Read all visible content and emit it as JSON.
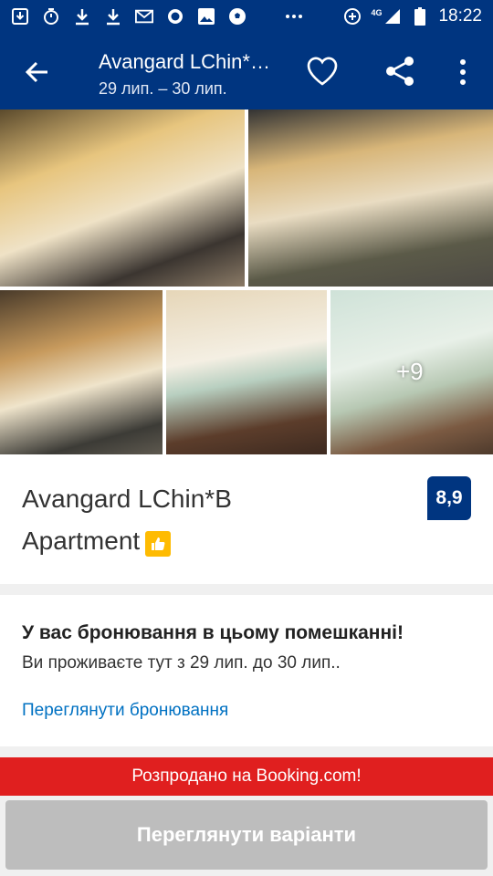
{
  "status_bar": {
    "time": "18:22",
    "network": "4G",
    "icons": [
      "download-box-icon",
      "timer-icon",
      "download-icon",
      "download-icon",
      "gmail-icon",
      "record-icon",
      "image-icon",
      "soccer-ball-icon",
      "more-dots-icon",
      "data-saver-icon",
      "signal-icon",
      "battery-icon"
    ]
  },
  "app_bar": {
    "title": "Avangard LChin*B Apartment",
    "dates": "29 лип. – 30 лип."
  },
  "gallery": {
    "more_photos": "+9"
  },
  "hotel": {
    "name": "Avangard LChin*B Apartment",
    "score": "8,9",
    "badge_color": "#febb02"
  },
  "booking": {
    "title": "У вас бронювання в цьому помешканні!",
    "subtitle": "Ви проживаєте тут з 29 лип. до 30 лип..",
    "link": "Переглянути бронювання"
  },
  "soldout": "Розпродано на Booking.com!",
  "cta": "Переглянути варіанти",
  "colors": {
    "brand": "#003580",
    "link": "#0071c2",
    "alert": "#e01f1f",
    "disabled": "#bdbdbd"
  }
}
